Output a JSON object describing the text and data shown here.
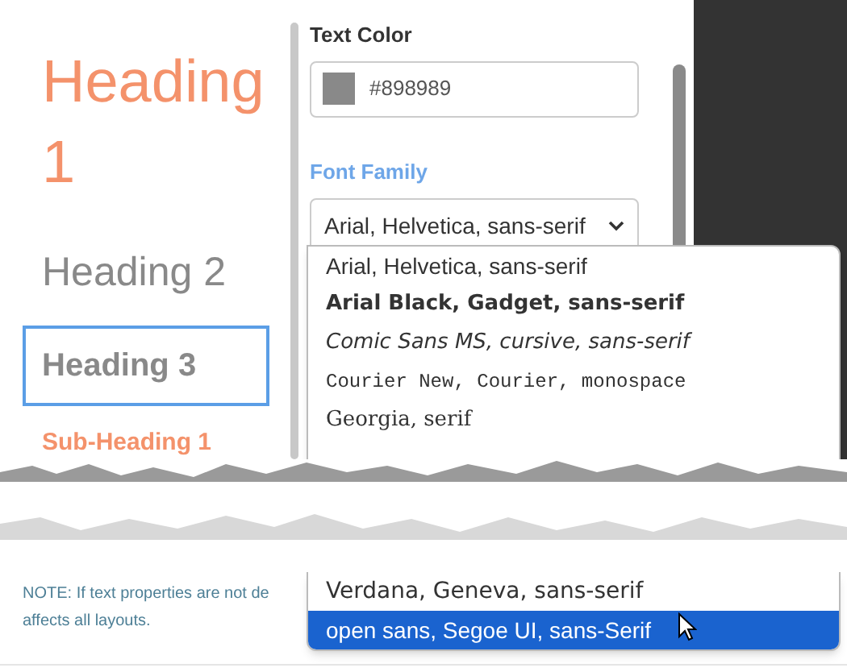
{
  "headings": [
    {
      "text": "Heading 1",
      "kind": "h1",
      "selected": false
    },
    {
      "text": "Heading 2",
      "kind": "h2",
      "selected": false
    },
    {
      "text": "Heading 3",
      "kind": "h3",
      "selected": true
    },
    {
      "text": "Sub-Heading 1",
      "kind": "sub",
      "selected": false
    }
  ],
  "text_color": {
    "label": "Text Color",
    "value": "#898989",
    "color": "#898989"
  },
  "font_family": {
    "label": "Font Family",
    "value": "Arial, Helvetica, sans-serif"
  },
  "dropdown": {
    "upper_options": [
      {
        "text": "Arial, Helvetica, sans-serif",
        "kind": "sans",
        "selected": false
      },
      {
        "text": "Arial Black, Gadget, sans-serif",
        "kind": "black",
        "selected": false
      },
      {
        "text": "Comic Sans MS, cursive, sans-serif",
        "kind": "comic",
        "selected": false
      },
      {
        "text": "Courier New, Courier, monospace",
        "kind": "mono",
        "selected": false
      },
      {
        "text": "Georgia, serif",
        "kind": "serif",
        "selected": false
      }
    ],
    "lower_options": [
      {
        "text": "Verdana, Geneva, sans-serif",
        "kind": "wide",
        "selected": false
      },
      {
        "text": "open sans, Segoe UI, sans-Serif",
        "kind": "sans",
        "selected": true
      }
    ]
  },
  "note": [
    "NOTE: If text properties are not de",
    "affects all layouts."
  ]
}
